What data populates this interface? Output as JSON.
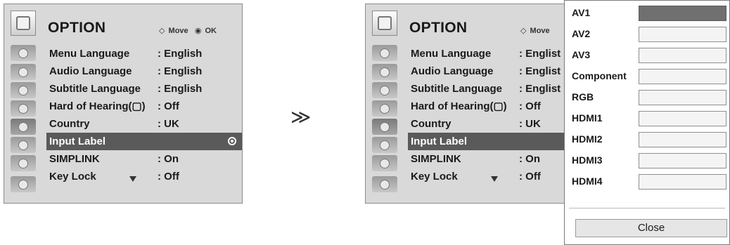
{
  "header": {
    "title": "OPTION",
    "move_glyph": "◇",
    "move_label": "Move",
    "ok_glyph": "◉",
    "ok_label": "OK",
    "move_label_right": "Move"
  },
  "sidebar_icons": [
    "picture-icon",
    "screen-icon",
    "audio-icon",
    "time-icon",
    "option-icon",
    "lock-icon",
    "usb-icon",
    "simplink-icon"
  ],
  "menu": [
    {
      "label": "Menu Language",
      "value": ": English"
    },
    {
      "label": "Audio Language",
      "value": ": English"
    },
    {
      "label": "Subtitle Language",
      "value": ": English"
    },
    {
      "label": "Hard of Hearing(▢)",
      "value": ": Off"
    },
    {
      "label": "Country",
      "value": ": UK"
    },
    {
      "label": "Input Label",
      "value": ""
    },
    {
      "label": "SIMPLINK",
      "value": ": On"
    },
    {
      "label": "Key Lock",
      "value": ": Off"
    }
  ],
  "menu_right": [
    {
      "label": "Menu Language",
      "value": ": Englist"
    },
    {
      "label": "Audio Language",
      "value": ": Englist"
    },
    {
      "label": "Subtitle Language",
      "value": ": Englist"
    },
    {
      "label": "Hard of Hearing(▢)",
      "value": ": Off"
    },
    {
      "label": "Country",
      "value": ": UK"
    },
    {
      "label": "Input Label",
      "value": ""
    },
    {
      "label": "SIMPLINK",
      "value": ": On"
    },
    {
      "label": "Key Lock",
      "value": ": Off"
    }
  ],
  "transition_arrow": "≫",
  "popup": {
    "items": [
      "AV1",
      "AV2",
      "AV3",
      "Component",
      "RGB",
      "HDMI1",
      "HDMI2",
      "HDMI3",
      "HDMI4"
    ],
    "close_label": "Close"
  }
}
